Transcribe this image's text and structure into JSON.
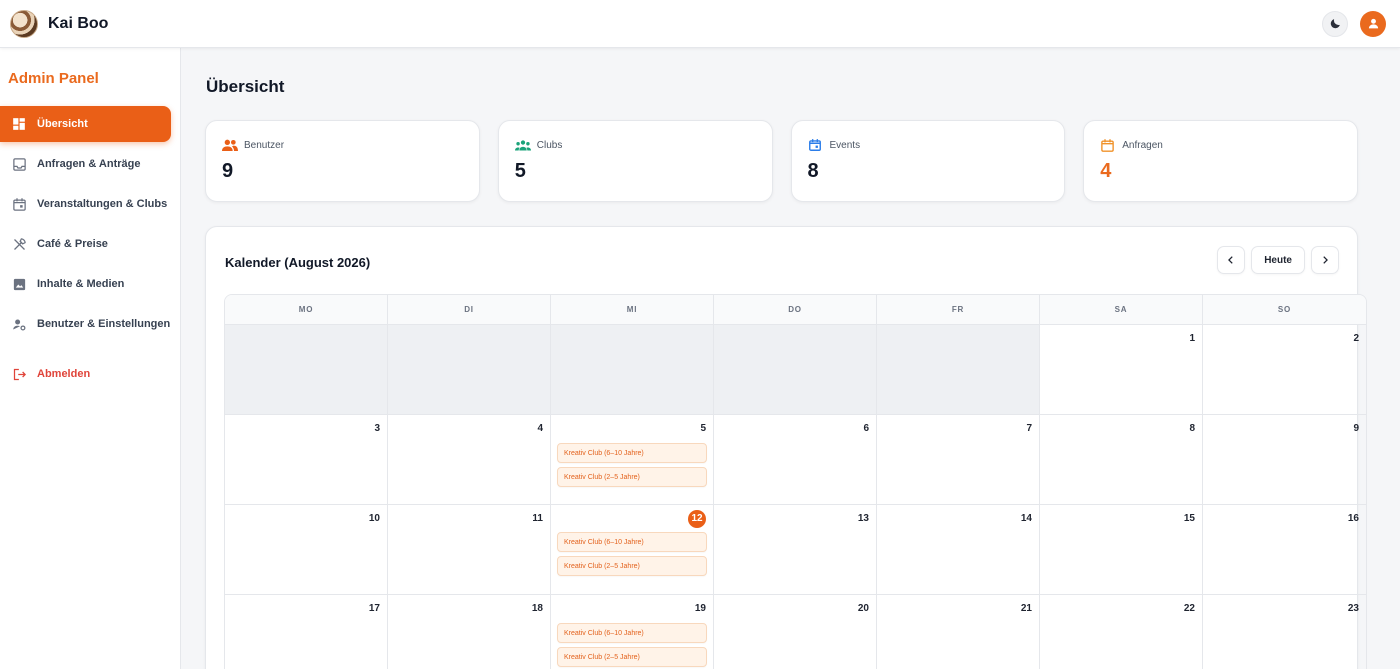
{
  "app": {
    "brand_name": "Kai Boo",
    "accent_color": "#ea5f17"
  },
  "topbar": {
    "theme_icon": "moon-icon",
    "user_icon": "user-icon"
  },
  "sidebar": {
    "title": "Admin Panel",
    "items": [
      {
        "label": "Übersicht",
        "icon": "dashboard-icon",
        "active": true
      },
      {
        "label": "Anfragen & Anträge",
        "icon": "inbox-icon"
      },
      {
        "label": "Veranstaltungen & Clubs",
        "icon": "calendar-icon"
      },
      {
        "label": "Café & Preise",
        "icon": "utensils-icon"
      },
      {
        "label": "Inhalte & Medien",
        "icon": "image-icon"
      },
      {
        "label": "Benutzer & Einstellungen",
        "icon": "users-settings-icon"
      }
    ],
    "logout_label": "Abmelden"
  },
  "page": {
    "title": "Übersicht"
  },
  "stats": [
    {
      "label": "Benutzer",
      "value": "9",
      "icon": "users-icon"
    },
    {
      "label": "Clubs",
      "value": "5",
      "icon": "groups-icon"
    },
    {
      "label": "Events",
      "value": "8",
      "icon": "event-icon"
    },
    {
      "label": "Anfragen",
      "value": "4",
      "icon": "calendar-outline-icon"
    }
  ],
  "calendar": {
    "title": "Kalender (August 2026)",
    "today_label": "Heute",
    "weekdays": [
      "MO",
      "DI",
      "MI",
      "DO",
      "FR",
      "SA",
      "SO"
    ],
    "today_day": "12",
    "weeks": [
      [
        {
          "day": ""
        },
        {
          "day": ""
        },
        {
          "day": ""
        },
        {
          "day": ""
        },
        {
          "day": ""
        },
        {
          "day": "1"
        },
        {
          "day": "2"
        }
      ],
      [
        {
          "day": "3"
        },
        {
          "day": "4"
        },
        {
          "day": "5",
          "events": [
            "Kreativ Club (6–10 Jahre)",
            "Kreativ Club (2–5 Jahre)"
          ]
        },
        {
          "day": "6"
        },
        {
          "day": "7"
        },
        {
          "day": "8"
        },
        {
          "day": "9"
        }
      ],
      [
        {
          "day": "10"
        },
        {
          "day": "11"
        },
        {
          "day": "12",
          "events": [
            "Kreativ Club (6–10 Jahre)",
            "Kreativ Club (2–5 Jahre)"
          ]
        },
        {
          "day": "13"
        },
        {
          "day": "14"
        },
        {
          "day": "15"
        },
        {
          "day": "16"
        }
      ],
      [
        {
          "day": "17"
        },
        {
          "day": "18"
        },
        {
          "day": "19",
          "events": [
            "Kreativ Club (6–10 Jahre)",
            "Kreativ Club (2–5 Jahre)"
          ]
        },
        {
          "day": "20"
        },
        {
          "day": "21"
        },
        {
          "day": "22"
        },
        {
          "day": "23"
        }
      ]
    ]
  }
}
